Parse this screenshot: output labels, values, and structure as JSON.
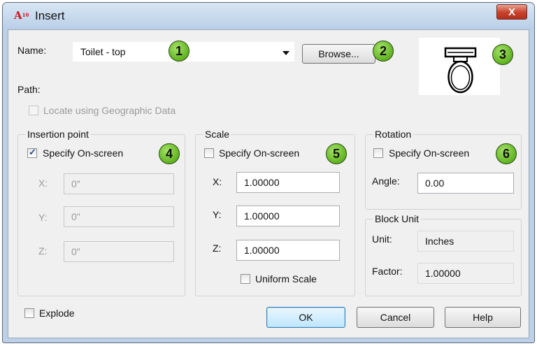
{
  "window": {
    "title": "Insert",
    "app_icon_text": "A",
    "app_icon_sub": "10",
    "close_label": "X"
  },
  "name": {
    "label": "Name:",
    "value": "Toilet - top",
    "browse_label": "Browse..."
  },
  "path": {
    "label": "Path:"
  },
  "geo": {
    "label": "Locate using Geographic Data",
    "checked": false,
    "enabled": false
  },
  "insertion": {
    "title": "Insertion point",
    "specify_label": "Specify On-screen",
    "specify_checked": true,
    "x_label": "X:",
    "x_value": "0\"",
    "y_label": "Y:",
    "y_value": "0\"",
    "z_label": "Z:",
    "z_value": "0\""
  },
  "scale": {
    "title": "Scale",
    "specify_label": "Specify On-screen",
    "specify_checked": false,
    "x_label": "X:",
    "x_value": "1.00000",
    "y_label": "Y:",
    "y_value": "1.00000",
    "z_label": "Z:",
    "z_value": "1.00000",
    "uniform_label": "Uniform Scale"
  },
  "rotation": {
    "title": "Rotation",
    "specify_label": "Specify On-screen",
    "specify_checked": false,
    "angle_label": "Angle:",
    "angle_value": "0.00"
  },
  "block_unit": {
    "title": "Block Unit",
    "unit_label": "Unit:",
    "unit_value": "Inches",
    "factor_label": "Factor:",
    "factor_value": "1.00000"
  },
  "explode": {
    "label": "Explode",
    "checked": false
  },
  "buttons": {
    "ok": "OK",
    "cancel": "Cancel",
    "help": "Help"
  },
  "callouts": [
    "1",
    "2",
    "3",
    "4",
    "5",
    "6"
  ],
  "colors": {
    "close_button": "#c7412c",
    "callout_fill": "#6fc22a",
    "titlebar": "#c8daee"
  }
}
